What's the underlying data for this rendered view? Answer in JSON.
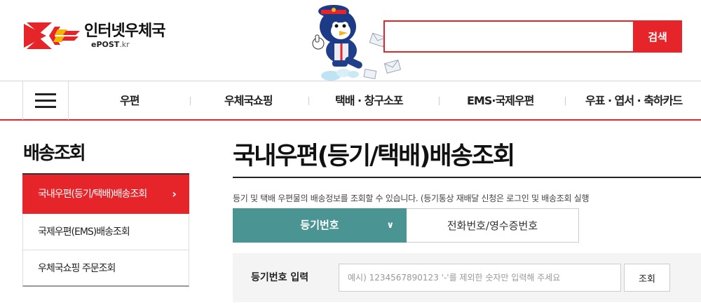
{
  "header": {
    "logo_ko": "인터넷우체국",
    "logo_en_main": "ePOST",
    "logo_en_tld": ".kr",
    "search_placeholder": "",
    "search_button": "검색"
  },
  "gnb": {
    "items": [
      "우편",
      "우체국쇼핑",
      "택배 · 창구소포",
      "EMS·국제우편",
      "우표 · 엽서 · 축하카드"
    ]
  },
  "sidebar": {
    "title": "배송조회",
    "items": [
      {
        "label": "국내우편(등기/택배)배송조회",
        "active": true
      },
      {
        "label": "국제우편(EMS)배송조회",
        "active": false
      },
      {
        "label": "우체국쇼핑 주문조회",
        "active": false
      }
    ]
  },
  "main": {
    "title": "국내우편(등기/택배)배송조회",
    "description": "등기 및 택배 우편물의 배송정보를 조회할 수 있습니다. (등기통상 재배달 신청은 로그인 및 배송조회 실행",
    "tabs": [
      {
        "label": "등기번호",
        "active": true
      },
      {
        "label": "전화번호/영수증번호",
        "active": false
      }
    ],
    "form": {
      "label": "등기번호 입력",
      "placeholder": "예시) 1234567890123 '-'를 제외한 숫자만 입력해 주세요",
      "button": "조회"
    }
  },
  "colors": {
    "brand_red": "#e6252a",
    "tab_teal": "#4b9494"
  }
}
